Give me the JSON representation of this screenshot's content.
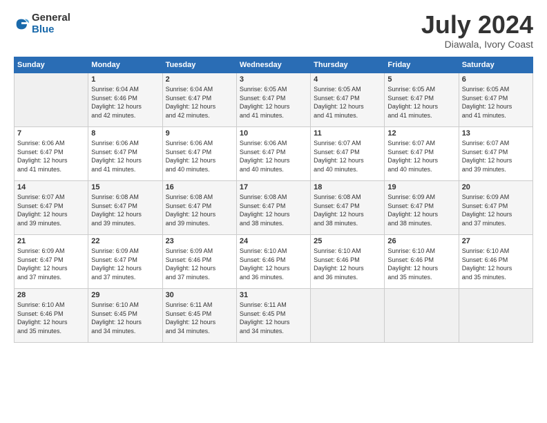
{
  "logo": {
    "general": "General",
    "blue": "Blue"
  },
  "title": "July 2024",
  "location": "Diawala, Ivory Coast",
  "days_header": [
    "Sunday",
    "Monday",
    "Tuesday",
    "Wednesday",
    "Thursday",
    "Friday",
    "Saturday"
  ],
  "weeks": [
    [
      {
        "day": "",
        "sunrise": "",
        "sunset": "",
        "daylight": ""
      },
      {
        "day": "1",
        "sunrise": "Sunrise: 6:04 AM",
        "sunset": "Sunset: 6:46 PM",
        "daylight": "Daylight: 12 hours and 42 minutes."
      },
      {
        "day": "2",
        "sunrise": "Sunrise: 6:04 AM",
        "sunset": "Sunset: 6:47 PM",
        "daylight": "Daylight: 12 hours and 42 minutes."
      },
      {
        "day": "3",
        "sunrise": "Sunrise: 6:05 AM",
        "sunset": "Sunset: 6:47 PM",
        "daylight": "Daylight: 12 hours and 41 minutes."
      },
      {
        "day": "4",
        "sunrise": "Sunrise: 6:05 AM",
        "sunset": "Sunset: 6:47 PM",
        "daylight": "Daylight: 12 hours and 41 minutes."
      },
      {
        "day": "5",
        "sunrise": "Sunrise: 6:05 AM",
        "sunset": "Sunset: 6:47 PM",
        "daylight": "Daylight: 12 hours and 41 minutes."
      },
      {
        "day": "6",
        "sunrise": "Sunrise: 6:05 AM",
        "sunset": "Sunset: 6:47 PM",
        "daylight": "Daylight: 12 hours and 41 minutes."
      }
    ],
    [
      {
        "day": "7",
        "sunrise": "Sunrise: 6:06 AM",
        "sunset": "Sunset: 6:47 PM",
        "daylight": "Daylight: 12 hours and 41 minutes."
      },
      {
        "day": "8",
        "sunrise": "Sunrise: 6:06 AM",
        "sunset": "Sunset: 6:47 PM",
        "daylight": "Daylight: 12 hours and 41 minutes."
      },
      {
        "day": "9",
        "sunrise": "Sunrise: 6:06 AM",
        "sunset": "Sunset: 6:47 PM",
        "daylight": "Daylight: 12 hours and 40 minutes."
      },
      {
        "day": "10",
        "sunrise": "Sunrise: 6:06 AM",
        "sunset": "Sunset: 6:47 PM",
        "daylight": "Daylight: 12 hours and 40 minutes."
      },
      {
        "day": "11",
        "sunrise": "Sunrise: 6:07 AM",
        "sunset": "Sunset: 6:47 PM",
        "daylight": "Daylight: 12 hours and 40 minutes."
      },
      {
        "day": "12",
        "sunrise": "Sunrise: 6:07 AM",
        "sunset": "Sunset: 6:47 PM",
        "daylight": "Daylight: 12 hours and 40 minutes."
      },
      {
        "day": "13",
        "sunrise": "Sunrise: 6:07 AM",
        "sunset": "Sunset: 6:47 PM",
        "daylight": "Daylight: 12 hours and 39 minutes."
      }
    ],
    [
      {
        "day": "14",
        "sunrise": "Sunrise: 6:07 AM",
        "sunset": "Sunset: 6:47 PM",
        "daylight": "Daylight: 12 hours and 39 minutes."
      },
      {
        "day": "15",
        "sunrise": "Sunrise: 6:08 AM",
        "sunset": "Sunset: 6:47 PM",
        "daylight": "Daylight: 12 hours and 39 minutes."
      },
      {
        "day": "16",
        "sunrise": "Sunrise: 6:08 AM",
        "sunset": "Sunset: 6:47 PM",
        "daylight": "Daylight: 12 hours and 39 minutes."
      },
      {
        "day": "17",
        "sunrise": "Sunrise: 6:08 AM",
        "sunset": "Sunset: 6:47 PM",
        "daylight": "Daylight: 12 hours and 38 minutes."
      },
      {
        "day": "18",
        "sunrise": "Sunrise: 6:08 AM",
        "sunset": "Sunset: 6:47 PM",
        "daylight": "Daylight: 12 hours and 38 minutes."
      },
      {
        "day": "19",
        "sunrise": "Sunrise: 6:09 AM",
        "sunset": "Sunset: 6:47 PM",
        "daylight": "Daylight: 12 hours and 38 minutes."
      },
      {
        "day": "20",
        "sunrise": "Sunrise: 6:09 AM",
        "sunset": "Sunset: 6:47 PM",
        "daylight": "Daylight: 12 hours and 37 minutes."
      }
    ],
    [
      {
        "day": "21",
        "sunrise": "Sunrise: 6:09 AM",
        "sunset": "Sunset: 6:47 PM",
        "daylight": "Daylight: 12 hours and 37 minutes."
      },
      {
        "day": "22",
        "sunrise": "Sunrise: 6:09 AM",
        "sunset": "Sunset: 6:47 PM",
        "daylight": "Daylight: 12 hours and 37 minutes."
      },
      {
        "day": "23",
        "sunrise": "Sunrise: 6:09 AM",
        "sunset": "Sunset: 6:46 PM",
        "daylight": "Daylight: 12 hours and 37 minutes."
      },
      {
        "day": "24",
        "sunrise": "Sunrise: 6:10 AM",
        "sunset": "Sunset: 6:46 PM",
        "daylight": "Daylight: 12 hours and 36 minutes."
      },
      {
        "day": "25",
        "sunrise": "Sunrise: 6:10 AM",
        "sunset": "Sunset: 6:46 PM",
        "daylight": "Daylight: 12 hours and 36 minutes."
      },
      {
        "day": "26",
        "sunrise": "Sunrise: 6:10 AM",
        "sunset": "Sunset: 6:46 PM",
        "daylight": "Daylight: 12 hours and 35 minutes."
      },
      {
        "day": "27",
        "sunrise": "Sunrise: 6:10 AM",
        "sunset": "Sunset: 6:46 PM",
        "daylight": "Daylight: 12 hours and 35 minutes."
      }
    ],
    [
      {
        "day": "28",
        "sunrise": "Sunrise: 6:10 AM",
        "sunset": "Sunset: 6:46 PM",
        "daylight": "Daylight: 12 hours and 35 minutes."
      },
      {
        "day": "29",
        "sunrise": "Sunrise: 6:10 AM",
        "sunset": "Sunset: 6:45 PM",
        "daylight": "Daylight: 12 hours and 34 minutes."
      },
      {
        "day": "30",
        "sunrise": "Sunrise: 6:11 AM",
        "sunset": "Sunset: 6:45 PM",
        "daylight": "Daylight: 12 hours and 34 minutes."
      },
      {
        "day": "31",
        "sunrise": "Sunrise: 6:11 AM",
        "sunset": "Sunset: 6:45 PM",
        "daylight": "Daylight: 12 hours and 34 minutes."
      },
      {
        "day": "",
        "sunrise": "",
        "sunset": "",
        "daylight": ""
      },
      {
        "day": "",
        "sunrise": "",
        "sunset": "",
        "daylight": ""
      },
      {
        "day": "",
        "sunrise": "",
        "sunset": "",
        "daylight": ""
      }
    ]
  ]
}
